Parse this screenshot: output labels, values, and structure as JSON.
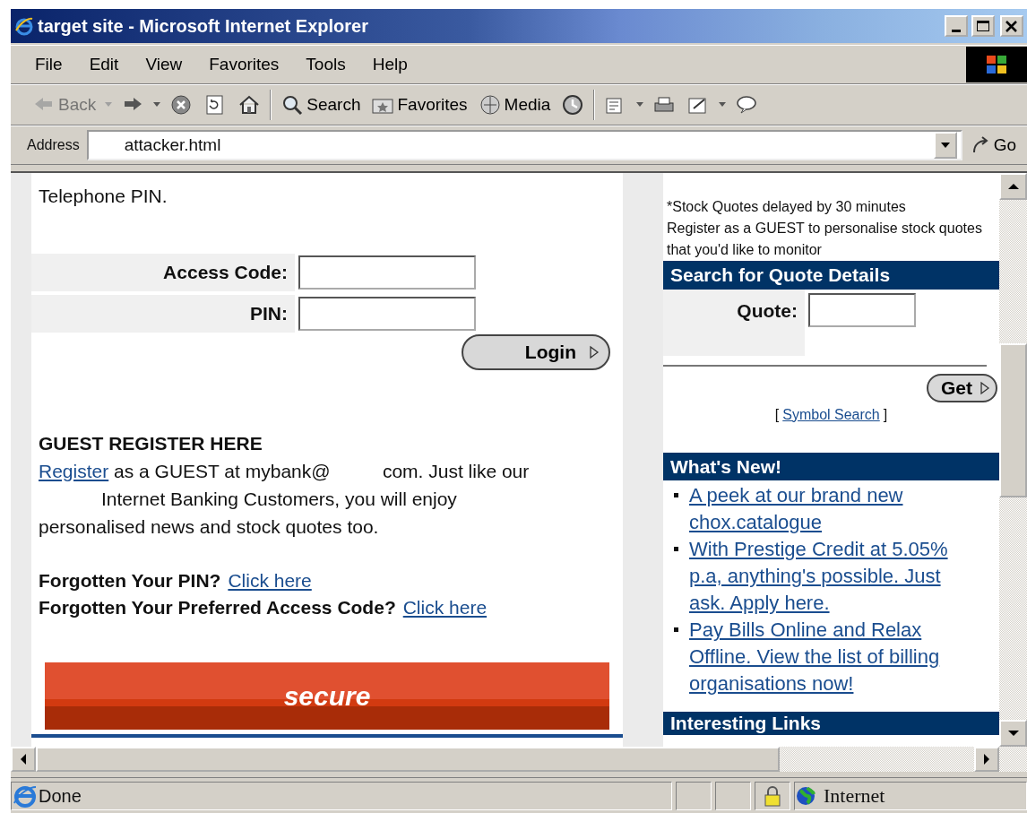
{
  "window": {
    "title": "target site - Microsoft Internet Explorer"
  },
  "menu": [
    "File",
    "Edit",
    "View",
    "Favorites",
    "Tools",
    "Help"
  ],
  "toolbar": [
    {
      "kind": "back",
      "label": "Back",
      "disabled": true,
      "caret": true
    },
    {
      "kind": "forward",
      "disabled": false,
      "caret": true
    },
    {
      "kind": "stop",
      "disabled": false
    },
    {
      "kind": "refresh",
      "disabled": false
    },
    {
      "kind": "home",
      "disabled": false
    },
    {
      "kind": "search",
      "label": "Search",
      "disabled": false
    },
    {
      "kind": "favorites",
      "label": "Favorites",
      "disabled": false
    },
    {
      "kind": "media",
      "label": "Media",
      "disabled": false
    },
    {
      "kind": "history",
      "disabled": false
    },
    {
      "kind": "mail",
      "disabled": false,
      "caret": true
    },
    {
      "kind": "print",
      "disabled": false
    },
    {
      "kind": "edit",
      "disabled": false,
      "caret": true
    },
    {
      "kind": "discuss",
      "disabled": false
    }
  ],
  "address": {
    "label": "Address",
    "value": "attacker.html",
    "go": "Go"
  },
  "left": {
    "intro": "Telephone PIN.",
    "fields": [
      {
        "label": "Access Code:"
      },
      {
        "label": "PIN:"
      }
    ],
    "login": "Login",
    "guest_heading": "GUEST REGISTER HERE",
    "register_link": "Register",
    "register_text": " as a GUEST at mybank@          com. Just like our\n            Internet Banking Customers, you will enjoy\npersonalised news and stock quotes too.",
    "forgotten": [
      {
        "label": "Forgotten Your PIN?",
        "link": "Click here"
      },
      {
        "label": "Forgotten Your Preferred Access Code?",
        "link": "Click here"
      }
    ],
    "banner": "secure"
  },
  "right": {
    "notes": [
      "*Stock Quotes delayed by 30 minutes",
      "Register as a GUEST to personalise stock quotes that you'd like to monitor"
    ],
    "quote_heading": "Search for Quote Details",
    "quote_label": "Quote:",
    "get": "Get",
    "symbol_open": "[",
    "symbol_link": "Symbol Search",
    "symbol_close": "]",
    "news_heading": "What's New!",
    "news": [
      "A peek at our brand new chox.catalogue",
      "With Prestige Credit at 5.05% p.a, anything's possible. Just ask. Apply here.",
      "Pay Bills Online and Relax Offline. View the list of billing organisations now!"
    ],
    "links_heading": "Interesting Links"
  },
  "status_bar": {
    "text": "Done",
    "zone": "Internet"
  }
}
